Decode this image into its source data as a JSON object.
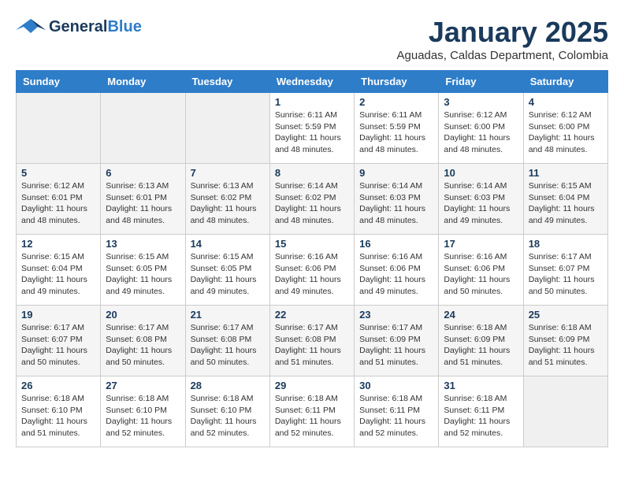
{
  "header": {
    "logo_general": "General",
    "logo_blue": "Blue",
    "month_year": "January 2025",
    "location": "Aguadas, Caldas Department, Colombia"
  },
  "weekdays": [
    "Sunday",
    "Monday",
    "Tuesday",
    "Wednesday",
    "Thursday",
    "Friday",
    "Saturday"
  ],
  "weeks": [
    [
      {
        "day": "",
        "sunrise": "",
        "sunset": "",
        "daylight": "",
        "empty": true
      },
      {
        "day": "",
        "sunrise": "",
        "sunset": "",
        "daylight": "",
        "empty": true
      },
      {
        "day": "",
        "sunrise": "",
        "sunset": "",
        "daylight": "",
        "empty": true
      },
      {
        "day": "1",
        "sunrise": "Sunrise: 6:11 AM",
        "sunset": "Sunset: 5:59 PM",
        "daylight": "Daylight: 11 hours and 48 minutes.",
        "empty": false
      },
      {
        "day": "2",
        "sunrise": "Sunrise: 6:11 AM",
        "sunset": "Sunset: 5:59 PM",
        "daylight": "Daylight: 11 hours and 48 minutes.",
        "empty": false
      },
      {
        "day": "3",
        "sunrise": "Sunrise: 6:12 AM",
        "sunset": "Sunset: 6:00 PM",
        "daylight": "Daylight: 11 hours and 48 minutes.",
        "empty": false
      },
      {
        "day": "4",
        "sunrise": "Sunrise: 6:12 AM",
        "sunset": "Sunset: 6:00 PM",
        "daylight": "Daylight: 11 hours and 48 minutes.",
        "empty": false
      }
    ],
    [
      {
        "day": "5",
        "sunrise": "Sunrise: 6:12 AM",
        "sunset": "Sunset: 6:01 PM",
        "daylight": "Daylight: 11 hours and 48 minutes.",
        "empty": false
      },
      {
        "day": "6",
        "sunrise": "Sunrise: 6:13 AM",
        "sunset": "Sunset: 6:01 PM",
        "daylight": "Daylight: 11 hours and 48 minutes.",
        "empty": false
      },
      {
        "day": "7",
        "sunrise": "Sunrise: 6:13 AM",
        "sunset": "Sunset: 6:02 PM",
        "daylight": "Daylight: 11 hours and 48 minutes.",
        "empty": false
      },
      {
        "day": "8",
        "sunrise": "Sunrise: 6:14 AM",
        "sunset": "Sunset: 6:02 PM",
        "daylight": "Daylight: 11 hours and 48 minutes.",
        "empty": false
      },
      {
        "day": "9",
        "sunrise": "Sunrise: 6:14 AM",
        "sunset": "Sunset: 6:03 PM",
        "daylight": "Daylight: 11 hours and 48 minutes.",
        "empty": false
      },
      {
        "day": "10",
        "sunrise": "Sunrise: 6:14 AM",
        "sunset": "Sunset: 6:03 PM",
        "daylight": "Daylight: 11 hours and 49 minutes.",
        "empty": false
      },
      {
        "day": "11",
        "sunrise": "Sunrise: 6:15 AM",
        "sunset": "Sunset: 6:04 PM",
        "daylight": "Daylight: 11 hours and 49 minutes.",
        "empty": false
      }
    ],
    [
      {
        "day": "12",
        "sunrise": "Sunrise: 6:15 AM",
        "sunset": "Sunset: 6:04 PM",
        "daylight": "Daylight: 11 hours and 49 minutes.",
        "empty": false
      },
      {
        "day": "13",
        "sunrise": "Sunrise: 6:15 AM",
        "sunset": "Sunset: 6:05 PM",
        "daylight": "Daylight: 11 hours and 49 minutes.",
        "empty": false
      },
      {
        "day": "14",
        "sunrise": "Sunrise: 6:15 AM",
        "sunset": "Sunset: 6:05 PM",
        "daylight": "Daylight: 11 hours and 49 minutes.",
        "empty": false
      },
      {
        "day": "15",
        "sunrise": "Sunrise: 6:16 AM",
        "sunset": "Sunset: 6:06 PM",
        "daylight": "Daylight: 11 hours and 49 minutes.",
        "empty": false
      },
      {
        "day": "16",
        "sunrise": "Sunrise: 6:16 AM",
        "sunset": "Sunset: 6:06 PM",
        "daylight": "Daylight: 11 hours and 49 minutes.",
        "empty": false
      },
      {
        "day": "17",
        "sunrise": "Sunrise: 6:16 AM",
        "sunset": "Sunset: 6:06 PM",
        "daylight": "Daylight: 11 hours and 50 minutes.",
        "empty": false
      },
      {
        "day": "18",
        "sunrise": "Sunrise: 6:17 AM",
        "sunset": "Sunset: 6:07 PM",
        "daylight": "Daylight: 11 hours and 50 minutes.",
        "empty": false
      }
    ],
    [
      {
        "day": "19",
        "sunrise": "Sunrise: 6:17 AM",
        "sunset": "Sunset: 6:07 PM",
        "daylight": "Daylight: 11 hours and 50 minutes.",
        "empty": false
      },
      {
        "day": "20",
        "sunrise": "Sunrise: 6:17 AM",
        "sunset": "Sunset: 6:08 PM",
        "daylight": "Daylight: 11 hours and 50 minutes.",
        "empty": false
      },
      {
        "day": "21",
        "sunrise": "Sunrise: 6:17 AM",
        "sunset": "Sunset: 6:08 PM",
        "daylight": "Daylight: 11 hours and 50 minutes.",
        "empty": false
      },
      {
        "day": "22",
        "sunrise": "Sunrise: 6:17 AM",
        "sunset": "Sunset: 6:08 PM",
        "daylight": "Daylight: 11 hours and 51 minutes.",
        "empty": false
      },
      {
        "day": "23",
        "sunrise": "Sunrise: 6:17 AM",
        "sunset": "Sunset: 6:09 PM",
        "daylight": "Daylight: 11 hours and 51 minutes.",
        "empty": false
      },
      {
        "day": "24",
        "sunrise": "Sunrise: 6:18 AM",
        "sunset": "Sunset: 6:09 PM",
        "daylight": "Daylight: 11 hours and 51 minutes.",
        "empty": false
      },
      {
        "day": "25",
        "sunrise": "Sunrise: 6:18 AM",
        "sunset": "Sunset: 6:09 PM",
        "daylight": "Daylight: 11 hours and 51 minutes.",
        "empty": false
      }
    ],
    [
      {
        "day": "26",
        "sunrise": "Sunrise: 6:18 AM",
        "sunset": "Sunset: 6:10 PM",
        "daylight": "Daylight: 11 hours and 51 minutes.",
        "empty": false
      },
      {
        "day": "27",
        "sunrise": "Sunrise: 6:18 AM",
        "sunset": "Sunset: 6:10 PM",
        "daylight": "Daylight: 11 hours and 52 minutes.",
        "empty": false
      },
      {
        "day": "28",
        "sunrise": "Sunrise: 6:18 AM",
        "sunset": "Sunset: 6:10 PM",
        "daylight": "Daylight: 11 hours and 52 minutes.",
        "empty": false
      },
      {
        "day": "29",
        "sunrise": "Sunrise: 6:18 AM",
        "sunset": "Sunset: 6:11 PM",
        "daylight": "Daylight: 11 hours and 52 minutes.",
        "empty": false
      },
      {
        "day": "30",
        "sunrise": "Sunrise: 6:18 AM",
        "sunset": "Sunset: 6:11 PM",
        "daylight": "Daylight: 11 hours and 52 minutes.",
        "empty": false
      },
      {
        "day": "31",
        "sunrise": "Sunrise: 6:18 AM",
        "sunset": "Sunset: 6:11 PM",
        "daylight": "Daylight: 11 hours and 52 minutes.",
        "empty": false
      },
      {
        "day": "",
        "sunrise": "",
        "sunset": "",
        "daylight": "",
        "empty": true
      }
    ]
  ]
}
